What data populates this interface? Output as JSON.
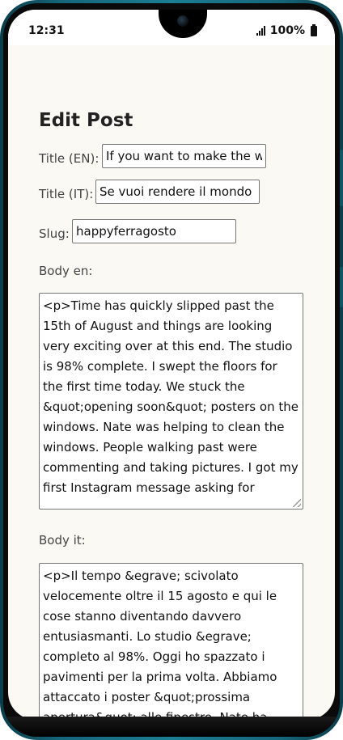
{
  "status_bar": {
    "time": "12:31",
    "battery": "100%",
    "icons": [
      "signal-icon",
      "battery-icon",
      "camera-icon"
    ]
  },
  "page": {
    "title": "Edit Post"
  },
  "form": {
    "title_en": {
      "label": "Title (EN):",
      "value": "If you want to make the w"
    },
    "title_it": {
      "label": "Title (IT):",
      "value": "Se vuoi rendere il mondo"
    },
    "slug": {
      "label": "Slug:",
      "value": "happyferragosto"
    },
    "body_en": {
      "label": "Body en:",
      "value": "<p>Time has quickly slipped past the 15th of August and things are looking very exciting over at this end. The studio is 98% complete. I swept the floors for the first time today. We stuck the &quot;opening soon&quot; posters on the windows. Nate was helping to clean the windows. People walking past were commenting and taking pictures. I got my first Instagram message asking for"
    },
    "body_it": {
      "label": "Body it:",
      "value": "<p>Il tempo &egrave; scivolato velocemente oltre il 15 agosto e qui le cose stanno diventando davvero entusiasmanti. Lo studio &egrave; completo al 98%. Oggi ho spazzato i pavimenti per la prima volta. Abbiamo attaccato i poster &quot;prossima apertura&quot; alle finestre. Nate ha"
    }
  }
}
